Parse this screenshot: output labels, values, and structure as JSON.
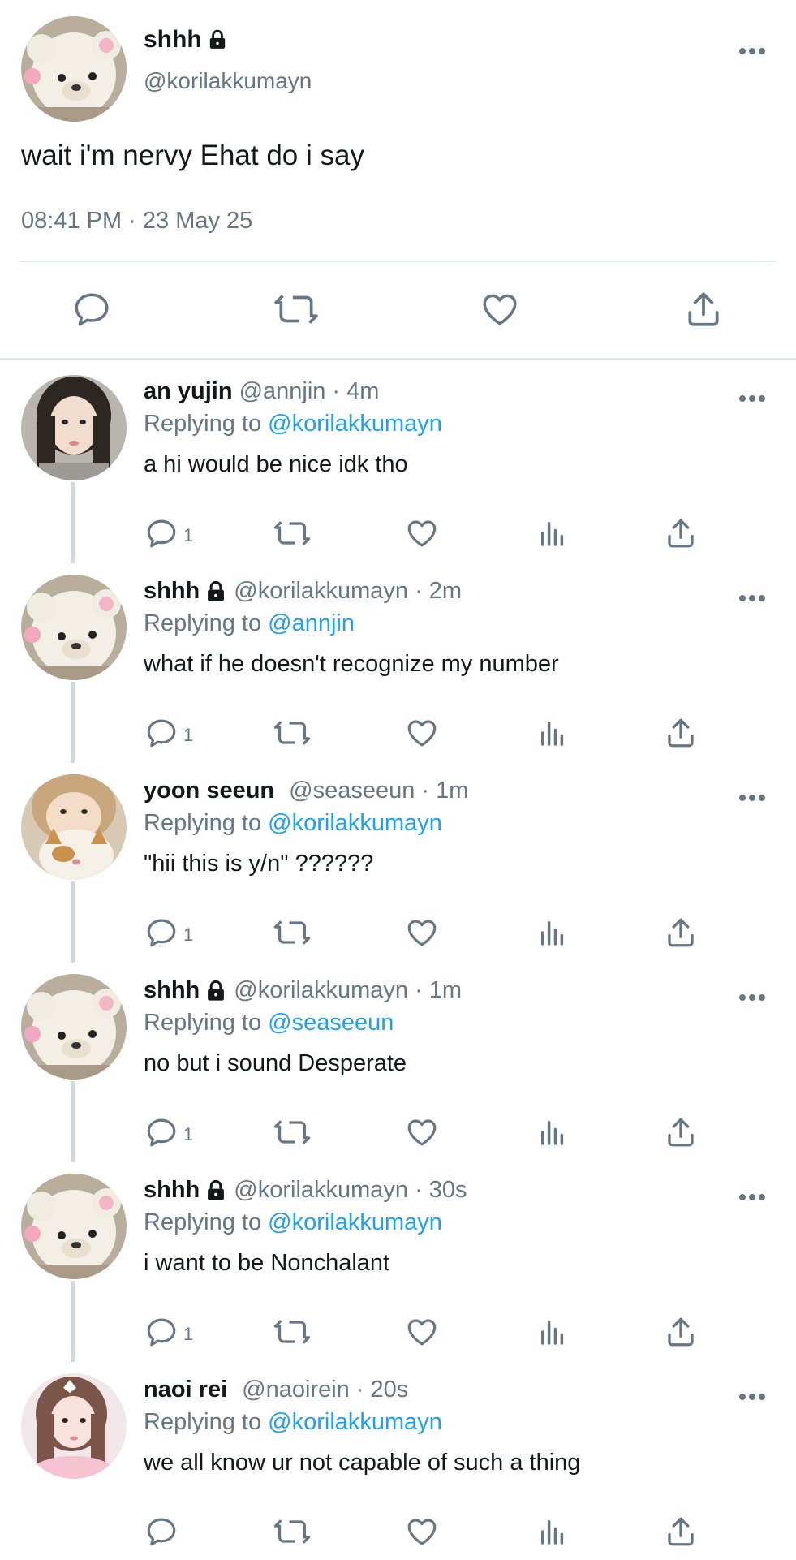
{
  "main_tweet": {
    "name": "shhh",
    "handle": "@korilakkumayn",
    "text": "wait i'm nervy Ehat do i say",
    "timestamp": "08:41 PM · 23 May 25",
    "icons": [
      "lock-icon",
      "more-icon",
      "reply-icon",
      "retweet-icon",
      "like-icon",
      "share-icon"
    ]
  },
  "replies": [
    {
      "name": "an yujin",
      "handle": "@annjin",
      "time": "· 4m",
      "replying_prefix": "Replying to",
      "replying_to": "@korilakkumayn",
      "text": "a hi would be nice idk tho",
      "reply_count": "1",
      "locked": false
    },
    {
      "name": "shhh",
      "handle": "@korilakkumayn",
      "time": "· 2m",
      "replying_prefix": "Replying to",
      "replying_to": "@annjin",
      "text": "what if he doesn't recognize my number",
      "reply_count": "1",
      "locked": true
    },
    {
      "name": "yoon seeun",
      "handle": "@seaseeun",
      "time": "· 1m",
      "replying_prefix": "Replying to",
      "replying_to": "@korilakkumayn",
      "text": "\"hii this is y/n\" ??????",
      "reply_count": "1",
      "locked": false
    },
    {
      "name": "shhh",
      "handle": "@korilakkumayn",
      "time": "· 1m",
      "replying_prefix": "Replying to",
      "replying_to": "@seaseeun",
      "text": "no but i sound Desperate",
      "reply_count": "1",
      "locked": true
    },
    {
      "name": "shhh",
      "handle": "@korilakkumayn",
      "time": "· 30s",
      "replying_prefix": "Replying to",
      "replying_to": "@korilakkumayn",
      "text": "i want to be Nonchalant",
      "reply_count": "1",
      "locked": true
    },
    {
      "name": "naoi rei",
      "handle": "@naoirein",
      "time": "· 20s",
      "replying_prefix": "Replying to",
      "replying_to": "@korilakkumayn",
      "text": "we all know ur not capable of such a thing",
      "reply_count": "",
      "locked": false
    }
  ],
  "colors": {
    "text": "#14171a",
    "muted": "#657786",
    "link": "#1da1f2",
    "divider": "#e1e8ed",
    "thread_line": "#cfd9de"
  }
}
